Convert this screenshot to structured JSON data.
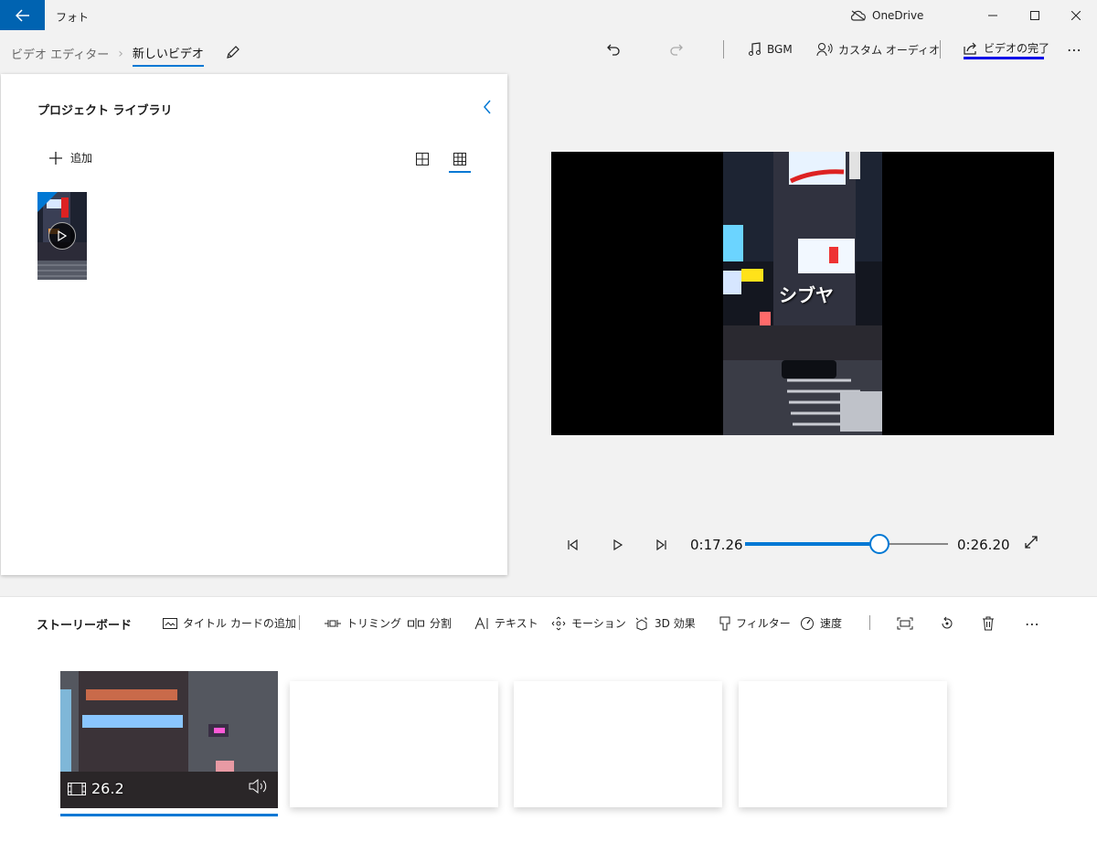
{
  "titlebar": {
    "app_title": "フォト",
    "onedrive_label": "OneDrive"
  },
  "header": {
    "breadcrumb_root": "ビデオ エディター",
    "breadcrumb_current": "新しいビデオ",
    "bgm_label": "BGM",
    "custom_audio_label": "カスタム オーディオ",
    "finish_label": "ビデオの完了"
  },
  "library": {
    "title": "プロジェクト ライブラリ",
    "add_label": "追加"
  },
  "preview": {
    "caption": "シブヤ"
  },
  "playback": {
    "current_time": "0:17.26",
    "total_time": "0:26.20",
    "progress_fraction": 0.664
  },
  "storyboard": {
    "title": "ストーリーボード",
    "tools": {
      "title_card": "タイトル カードの追加",
      "trim": "トリミング",
      "split": "分割",
      "text": "テキスト",
      "motion": "モーション",
      "effects_3d": "3D 効果",
      "filter": "フィルター",
      "speed": "速度"
    },
    "clips": [
      {
        "duration": "26.2"
      }
    ],
    "empty_slots": 3
  },
  "colors": {
    "accent": "#0078d4",
    "back_button": "#0063b1",
    "finish_underline": "#0000e8"
  }
}
